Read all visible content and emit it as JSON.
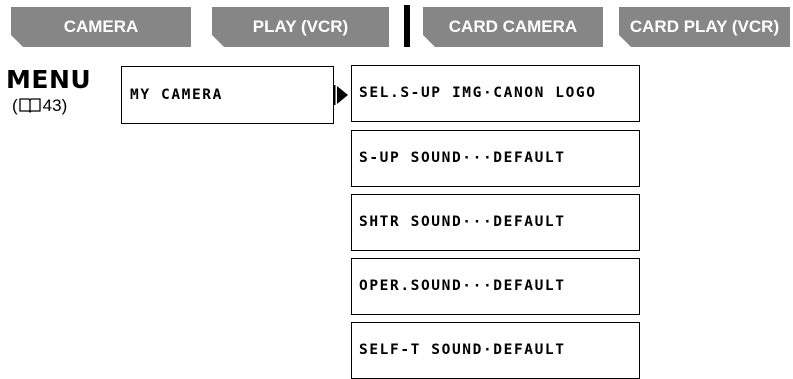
{
  "tabs": {
    "camera": "CAMERA",
    "play_vcr": "PLAY (VCR)",
    "card_camera": "CARD CAMERA",
    "card_play_vcr": "CARD PLAY (VCR)"
  },
  "menu": {
    "heading": "MENU",
    "ref_open": "(",
    "ref_page": "43)",
    "ref_icon": "book-icon"
  },
  "submenu": {
    "label": "MY CAMERA"
  },
  "settings": [
    "SEL.S-UP IMG·CANON LOGO",
    "S-UP SOUND···DEFAULT",
    "SHTR SOUND···DEFAULT",
    "OPER.SOUND···DEFAULT",
    "SELF-T SOUND·DEFAULT"
  ],
  "colors": {
    "tab_bg": "#868686",
    "tab_text": "#ffffff",
    "line": "#000000"
  }
}
